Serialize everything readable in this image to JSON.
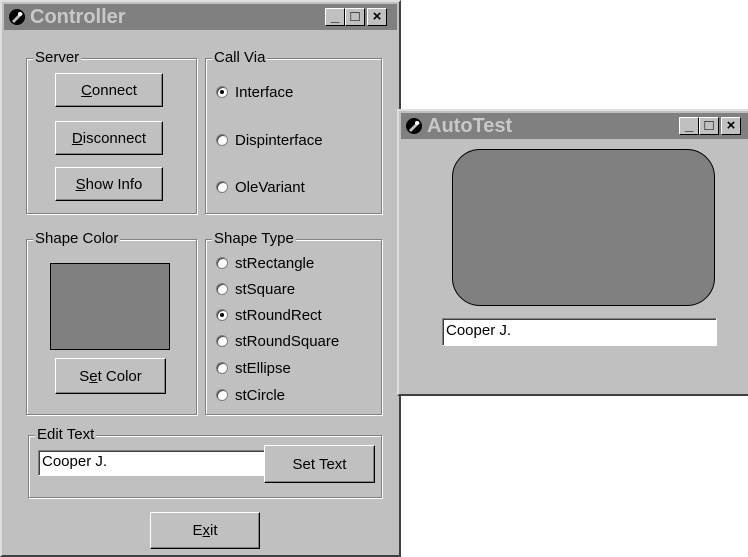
{
  "controller": {
    "title": "Controller",
    "title_buttons": {
      "minimize": "_",
      "maximize": "□",
      "close": "×"
    },
    "server": {
      "label": "Server",
      "connect": {
        "pre": "",
        "key": "C",
        "post": "onnect"
      },
      "disconnect": {
        "pre": "",
        "key": "D",
        "post": "isconnect"
      },
      "show_info": {
        "pre": "",
        "key": "S",
        "post": "how Info"
      }
    },
    "call_via": {
      "label": "Call Via",
      "options": [
        {
          "label": "Interface",
          "selected": true
        },
        {
          "label": "Dispinterface",
          "selected": false
        },
        {
          "label": "OleVariant",
          "selected": false
        }
      ]
    },
    "shape_color": {
      "label": "Shape Color",
      "swatch_color": "#808080",
      "set_color": {
        "pre": "S",
        "key": "e",
        "post": "t Color"
      }
    },
    "shape_type": {
      "label": "Shape Type",
      "options": [
        {
          "label": "stRectangle",
          "selected": false
        },
        {
          "label": "stSquare",
          "selected": false
        },
        {
          "label": "stRoundRect",
          "selected": true
        },
        {
          "label": "stRoundSquare",
          "selected": false
        },
        {
          "label": "stEllipse",
          "selected": false
        },
        {
          "label": "stCircle",
          "selected": false
        }
      ]
    },
    "edit_text": {
      "label": "Edit Text",
      "value": "Cooper J.",
      "set_text": "Set Text"
    },
    "exit": {
      "pre": "E",
      "key": "x",
      "post": "it"
    }
  },
  "autotest": {
    "title": "AutoTest",
    "title_buttons": {
      "minimize": "_",
      "maximize": "□",
      "close": "×"
    },
    "shape_color": "#808080",
    "text": "Cooper J."
  }
}
